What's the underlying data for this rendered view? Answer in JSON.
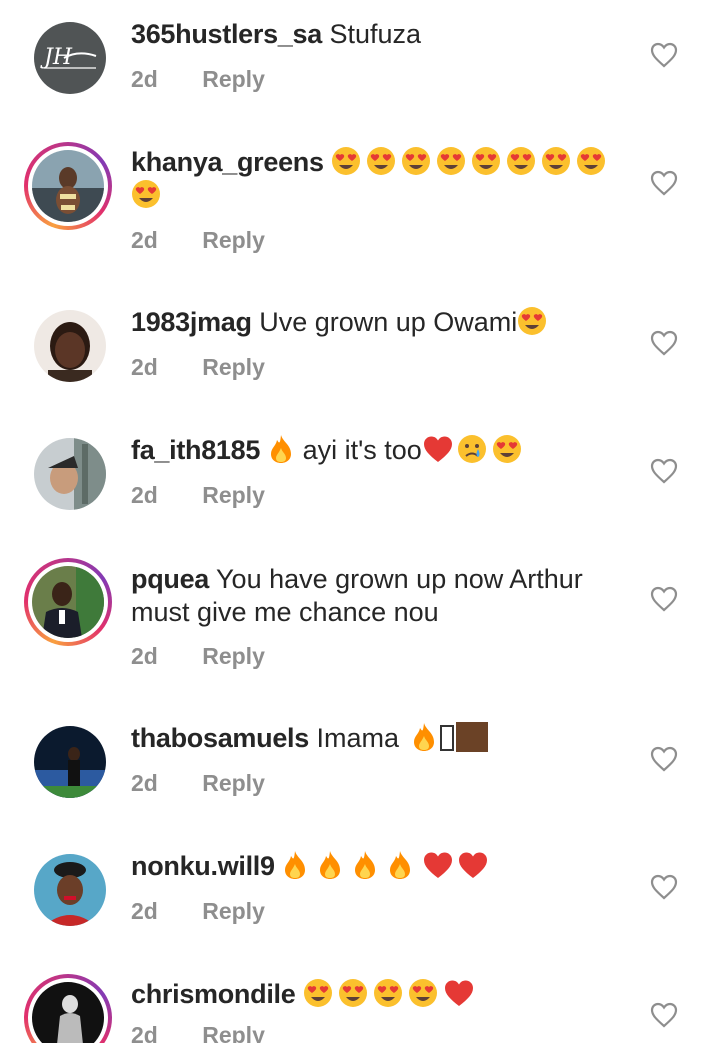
{
  "comments": [
    {
      "username": "365hustlers_sa",
      "text": "Stufuza",
      "time": "2d",
      "reply": "Reply",
      "avatar": "logo-dark",
      "ring": false,
      "emojis": []
    },
    {
      "username": "khanya_greens",
      "text": "",
      "time": "2d",
      "reply": "Reply",
      "avatar": "photo-beach",
      "ring": true,
      "emojis": [
        "heart-eyes",
        "heart-eyes",
        "heart-eyes",
        "heart-eyes",
        "heart-eyes",
        "heart-eyes",
        "heart-eyes",
        "heart-eyes",
        "heart-eyes"
      ]
    },
    {
      "username": "1983jmag",
      "text": "Uve grown up Owami",
      "time": "2d",
      "reply": "Reply",
      "avatar": "photo-woman",
      "ring": false,
      "emojis": [
        "heart-eyes"
      ]
    },
    {
      "username": "fa_ith8185",
      "text": "ayi it's too",
      "time": "2d",
      "reply": "Reply",
      "avatar": "photo-city",
      "ring": false,
      "emojis_before": [
        "fire"
      ],
      "emojis": [
        "red-heart",
        "crying-face",
        "heart-eyes"
      ]
    },
    {
      "username": "pquea",
      "text": "You have grown up now Arthur must give me chance nou",
      "time": "2d",
      "reply": "Reply",
      "avatar": "photo-man-suit",
      "ring": true,
      "emojis": []
    },
    {
      "username": "thabosamuels",
      "text": "Imama",
      "time": "2d",
      "reply": "Reply",
      "avatar": "photo-car",
      "ring": false,
      "emojis": [
        "fire",
        "tofu",
        "brown-square"
      ]
    },
    {
      "username": "nonku.will9",
      "text": "",
      "time": "2d",
      "reply": "Reply",
      "avatar": "photo-woman-hat",
      "ring": false,
      "emojis": [
        "fire",
        "fire",
        "fire",
        "fire",
        "red-heart",
        "red-heart"
      ]
    },
    {
      "username": "chrismondile",
      "text": "",
      "time": "2d",
      "reply": "Reply",
      "avatar": "photo-bw-man",
      "ring": true,
      "emojis": [
        "heart-eyes",
        "heart-eyes",
        "heart-eyes",
        "heart-eyes",
        "red-heart"
      ]
    }
  ],
  "icons": {
    "like": "heart-outline-icon"
  },
  "colors": {
    "username": "#262626",
    "meta": "#8e8e8e",
    "like_icon": "#8e8e8e"
  }
}
